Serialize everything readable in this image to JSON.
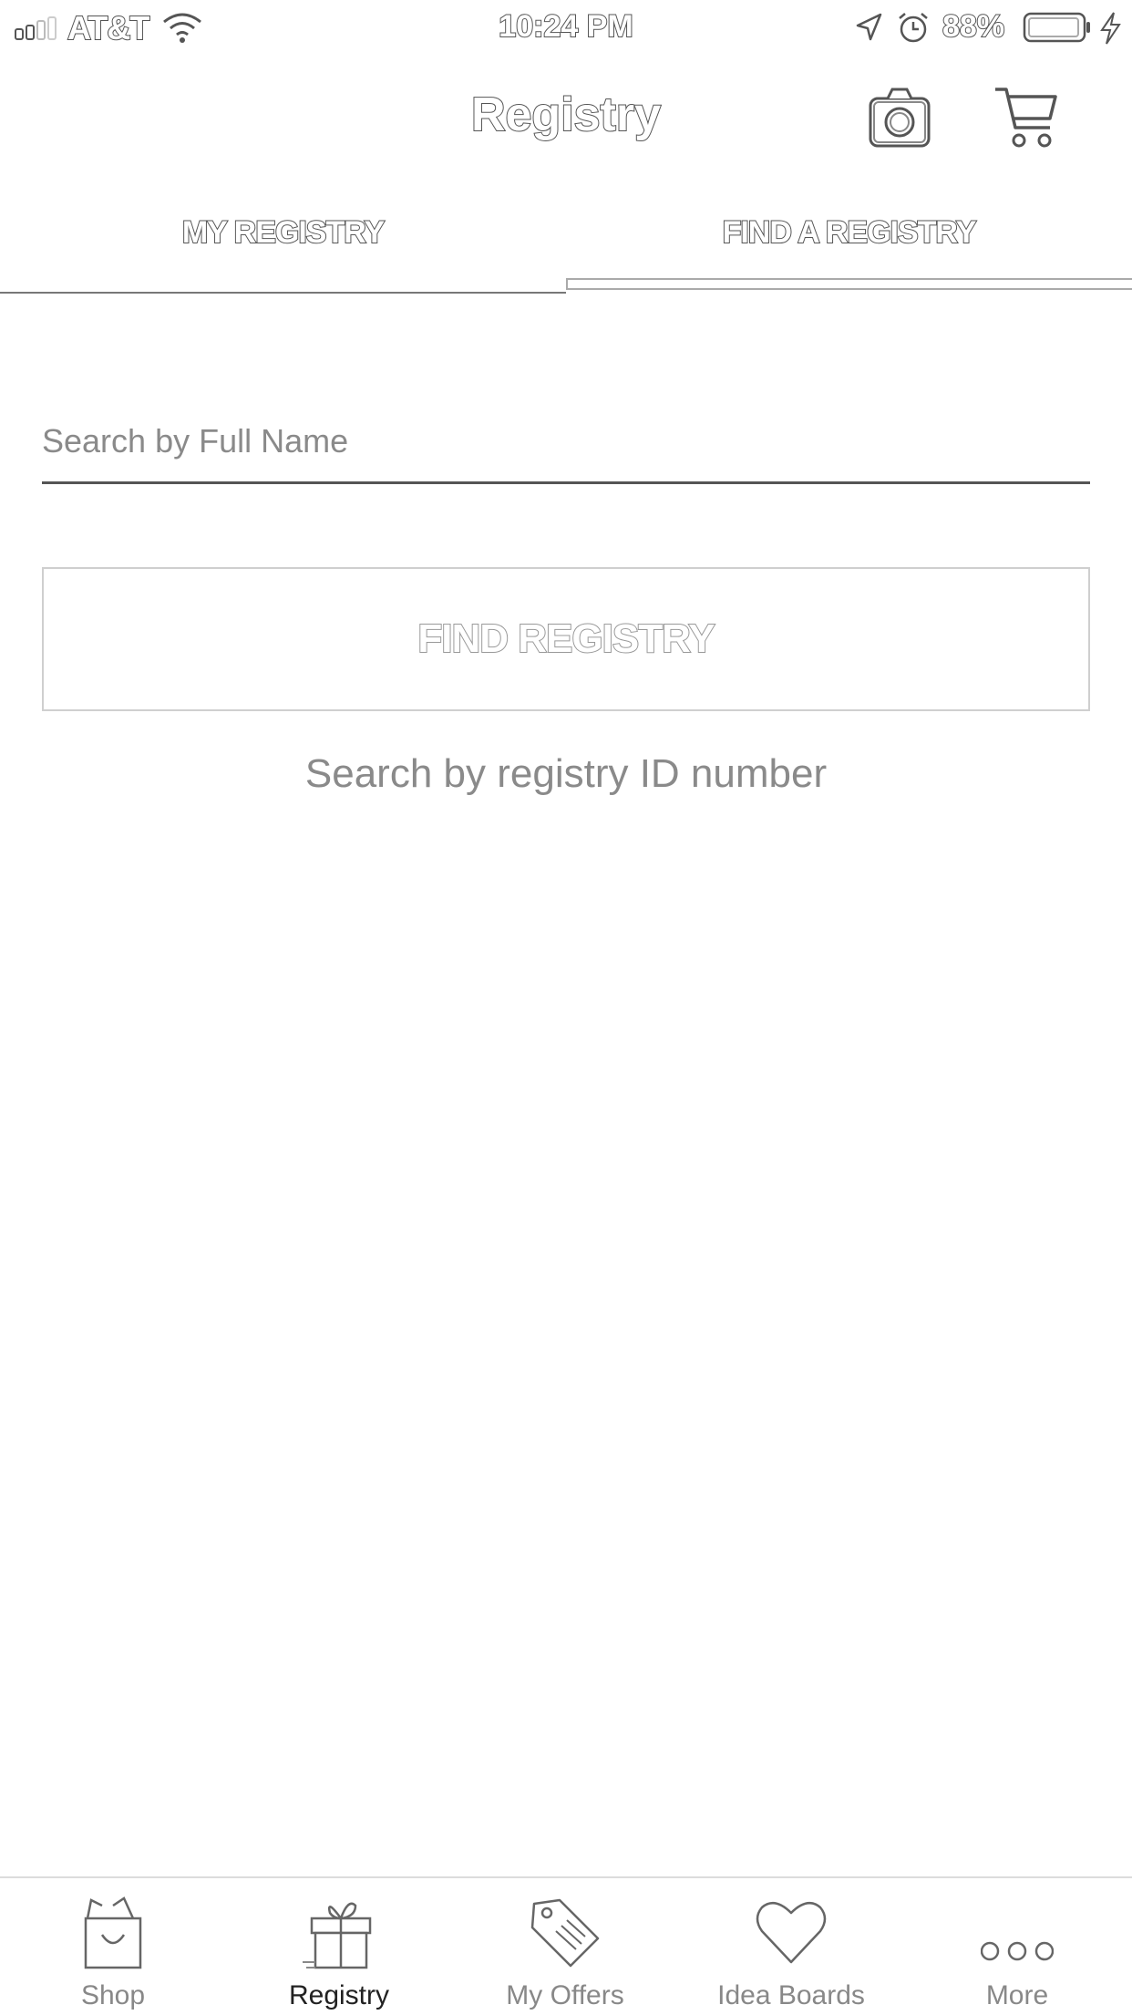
{
  "status_bar": {
    "carrier": "AT&T",
    "time": "10:24 PM",
    "battery_percent": "88%"
  },
  "header": {
    "title": "Registry"
  },
  "tabs": [
    {
      "label": "MY REGISTRY",
      "active": false
    },
    {
      "label": "FIND A REGISTRY",
      "active": true
    }
  ],
  "search": {
    "value": "",
    "placeholder": "Search by Full Name"
  },
  "find_button": {
    "label": "FIND REGISTRY"
  },
  "id_search_link": "Search by registry ID number",
  "tab_bar": {
    "items": [
      {
        "label": "Shop",
        "icon": "shopping-bag-icon",
        "active": false
      },
      {
        "label": "Registry",
        "icon": "gift-icon",
        "active": true
      },
      {
        "label": "My Offers",
        "icon": "tag-icon",
        "active": false
      },
      {
        "label": "Idea Boards",
        "icon": "heart-icon",
        "active": false
      },
      {
        "label": "More",
        "icon": "more-dots-icon",
        "active": false
      }
    ]
  }
}
